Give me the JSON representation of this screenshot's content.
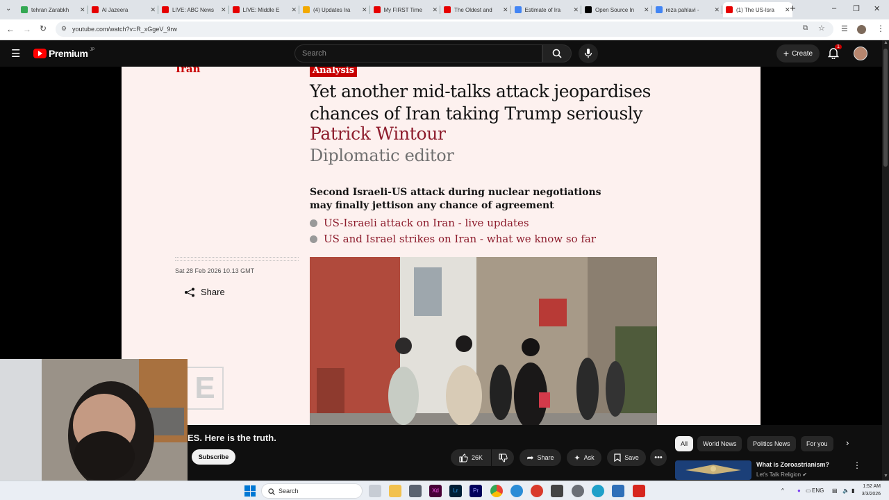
{
  "browser": {
    "tabs": [
      {
        "label": "tehran Zarabkh",
        "color": "#34a853"
      },
      {
        "label": "Al Jazeera",
        "color": "#e60000"
      },
      {
        "label": "LIVE: ABC News",
        "color": "#e60000"
      },
      {
        "label": "LIVE: Middle E",
        "color": "#e60000"
      },
      {
        "label": "(4) Updates Ira",
        "color": "#f2a900"
      },
      {
        "label": "My FIRST Time",
        "color": "#e60000"
      },
      {
        "label": "The Oldest and",
        "color": "#e60000"
      },
      {
        "label": "Estimate of Ira",
        "color": "#4285f4"
      },
      {
        "label": "Open Source In",
        "color": "#000000"
      },
      {
        "label": "reza pahlavi -",
        "color": "#4285f4"
      },
      {
        "label": "(1) The US-Isra",
        "color": "#e60000"
      }
    ],
    "url": "youtube.com/watch?v=R_xGgeV_9rw"
  },
  "youtube": {
    "logo": "Premium",
    "logo_region": "JP",
    "search_placeholder": "Search",
    "create_label": "Create",
    "notification_count": "1"
  },
  "article": {
    "kicker": "Iran",
    "badge": "Analysis",
    "headline": "Yet another mid-talks attack jeopardises chances of Iran taking Trump seriously",
    "byline": "Patrick Wintour",
    "role": "Diplomatic editor",
    "standfirst": "Second Israeli-US attack during nuclear negotiations may finally jettison any chance of agreement",
    "related": [
      "US-Israeli attack on Iran - live updates",
      "US and Israel strikes on Iran - what we know so far"
    ],
    "dateline": "Sat 28 Feb 2026 10.13 GMT",
    "share_label": "Share"
  },
  "video": {
    "title_partial": "ES. Here is the truth.",
    "subscribe_label": "Subscribe",
    "likes": "26K",
    "share_label": "Share",
    "ask_label": "Ask",
    "save_label": "Save"
  },
  "sidebar": {
    "chips": [
      "All",
      "World News",
      "Politics News",
      "For you"
    ],
    "recommendation": {
      "title": "What is Zoroastrianism?",
      "channel": "Let's Talk Religion"
    }
  },
  "taskbar": {
    "search_label": "Search",
    "language": "ENG",
    "time": "1:52 AM",
    "date": "3/3/2026"
  },
  "colors": {
    "guardian_red": "#c70000",
    "guardian_byline": "#8d1c2c",
    "youtube_red": "#ff0000"
  }
}
